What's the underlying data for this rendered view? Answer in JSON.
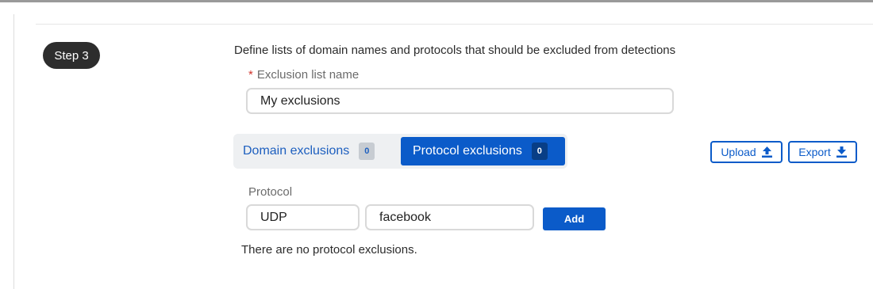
{
  "step": {
    "label": "Step 3"
  },
  "section": {
    "description": "Define lists of domain names and protocols that should be excluded from detections"
  },
  "exclusion_name": {
    "required_mark": "*",
    "label": "Exclusion list name",
    "value": "My exclusions"
  },
  "tabs": [
    {
      "label": "Domain exclusions",
      "count": "0",
      "active": false
    },
    {
      "label": "Protocol exclusions",
      "count": "0",
      "active": true
    }
  ],
  "actions": {
    "upload_label": "Upload",
    "export_label": "Export"
  },
  "protocol_form": {
    "label": "Protocol",
    "type_value": "UDP",
    "name_value": "facebook",
    "add_label": "Add"
  },
  "empty_message": "There are no protocol exclusions.",
  "colors": {
    "accent": "#0b5bc9",
    "accent_dark": "#083e86",
    "badge_bg": "#2d2d2d",
    "required": "#d0342c"
  },
  "icons": {
    "upload": "upload-arrow-icon",
    "export": "download-arrow-icon"
  }
}
